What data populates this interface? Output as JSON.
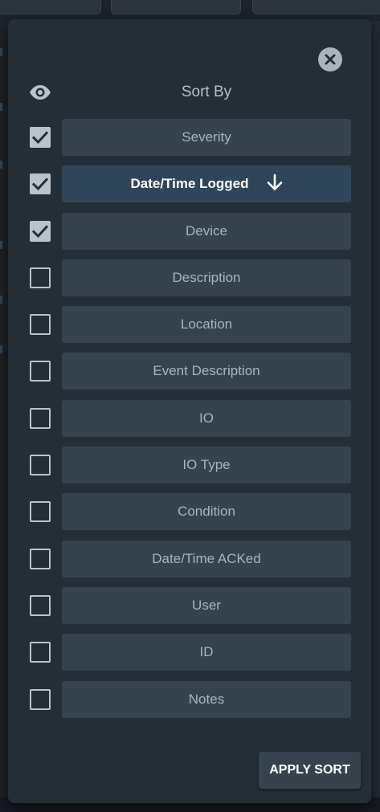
{
  "sort_panel": {
    "title": "Sort By",
    "apply_label": "APPLY SORT",
    "fields": [
      {
        "label": "Severity",
        "checked": true,
        "active": false
      },
      {
        "label": "Date/Time Logged",
        "checked": true,
        "active": true,
        "direction": "descending"
      },
      {
        "label": "Device",
        "checked": true,
        "active": false
      },
      {
        "label": "Description",
        "checked": false,
        "active": false
      },
      {
        "label": "Location",
        "checked": false,
        "active": false
      },
      {
        "label": "Event Description",
        "checked": false,
        "active": false
      },
      {
        "label": "IO",
        "checked": false,
        "active": false
      },
      {
        "label": "IO Type",
        "checked": false,
        "active": false
      },
      {
        "label": "Condition",
        "checked": false,
        "active": false
      },
      {
        "label": "Date/Time ACKed",
        "checked": false,
        "active": false
      },
      {
        "label": "User",
        "checked": false,
        "active": false
      },
      {
        "label": "ID",
        "checked": false,
        "active": false
      },
      {
        "label": "Notes",
        "checked": false,
        "active": false
      }
    ]
  },
  "icons": {
    "close": "close-icon",
    "visibility": "eye-icon",
    "check": "check-icon",
    "sort_direction": "arrow-down-icon"
  },
  "colors": {
    "panel_bg": "#242e36",
    "button_bg": "#36434d",
    "active_button_bg": "#2f4559",
    "checkbox": "#b9c3cb"
  }
}
